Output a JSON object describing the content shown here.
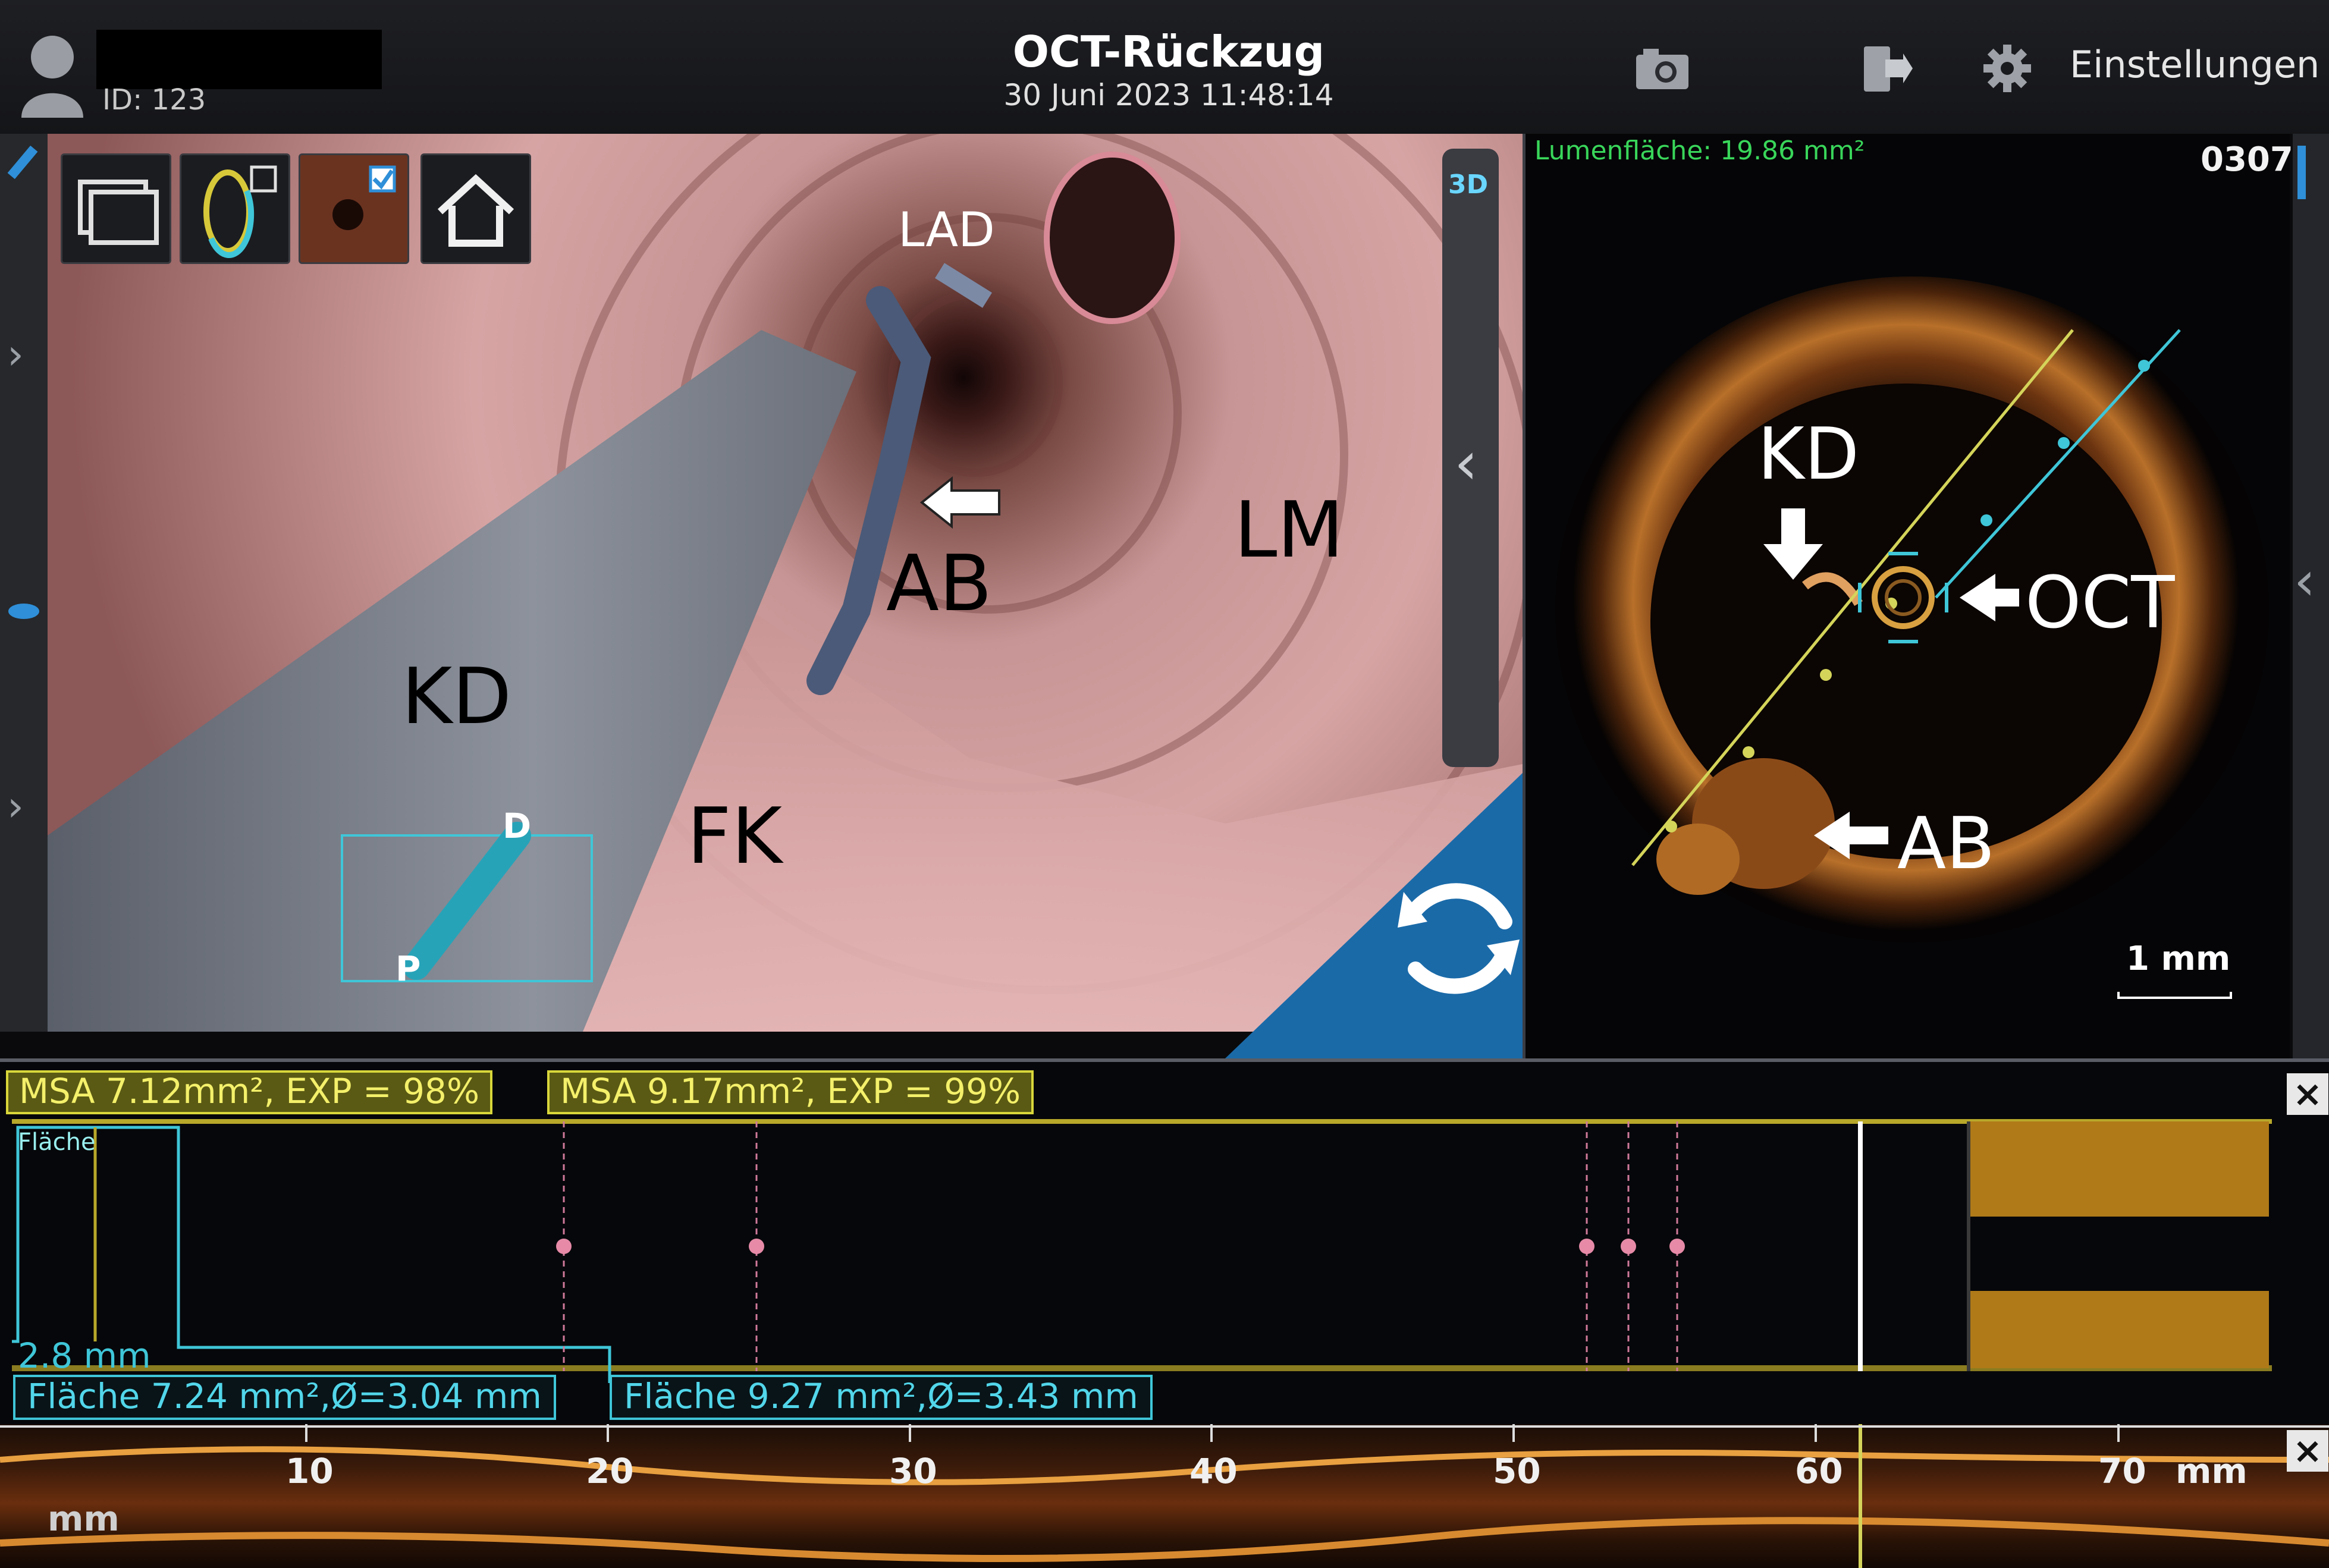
{
  "header": {
    "patient_id": "ID: 123",
    "title": "OCT-Rückzug",
    "datetime": "30 Juni 2023 11:48:14",
    "settings_label": "Einstellungen",
    "icons": [
      "camera-icon",
      "export-icon",
      "gear-icon"
    ]
  },
  "view3d": {
    "labels": {
      "lad": "LAD",
      "ab": "AB",
      "lm": "LM",
      "kd": "KD",
      "fk": "FK",
      "distal": "D",
      "proximal": "P"
    },
    "toggle_3d": "3D",
    "toolbar_icons": [
      "layers-icon",
      "ring-icon",
      "endoscope-icon",
      "home-icon"
    ],
    "thumbnail_checked": true
  },
  "oct": {
    "lumen_area": "Lumenfläche: 19.86 mm²",
    "frame": "0307",
    "labels": {
      "kd": "KD",
      "oct": "OCT",
      "ab": "AB"
    },
    "scale": "1 mm"
  },
  "lmode": {
    "msa_1": "MSA 7.12mm², EXP = 98%",
    "msa_2": "MSA 9.17mm², EXP = 99%",
    "flaeche_tag": "Fläche",
    "mm_tag": "2.8 mm",
    "area_1": "Fläche 7.24 mm²,Ø=3.04 mm",
    "area_2": "Fläche 9.27 mm²,Ø=3.43 mm"
  },
  "strip": {
    "ticks": [
      "10",
      "20",
      "30",
      "40",
      "50",
      "60",
      "70"
    ],
    "unit_right": "mm",
    "unit_left": "mm"
  },
  "colors": {
    "accent_cyan": "#3fc6d8",
    "accent_yellow": "#d8d63a",
    "lumen_green": "#39d65a",
    "catheter_blue": "#1a6aa8"
  }
}
